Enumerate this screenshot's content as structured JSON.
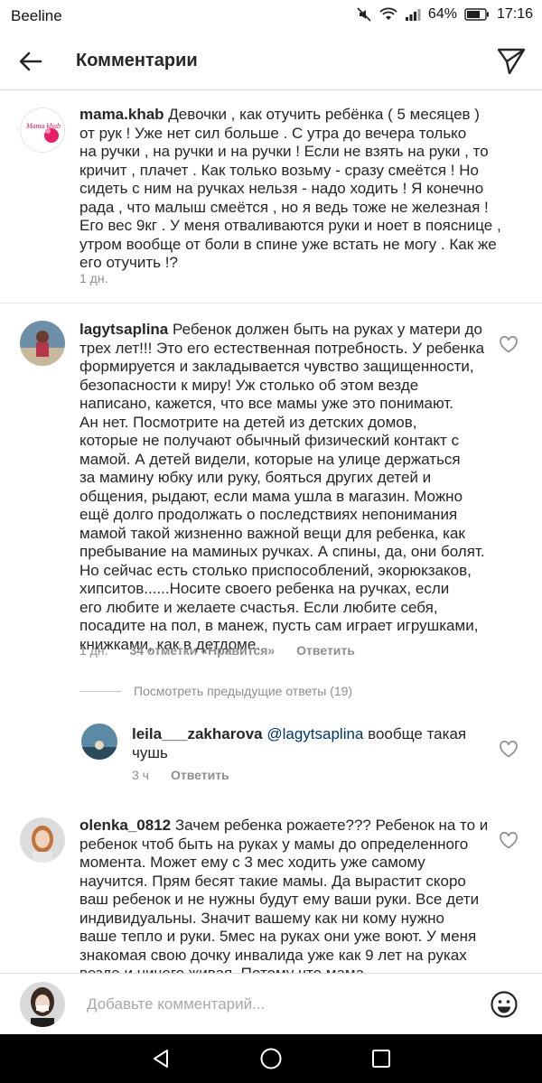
{
  "status_bar": {
    "carrier": "Beeline",
    "battery": "64%",
    "time": "17:16",
    "icons": [
      "mute-icon",
      "wifi-icon",
      "signal-icon",
      "battery-icon"
    ]
  },
  "header": {
    "title": "Комментарии",
    "back_icon": "back-arrow-icon",
    "share_icon": "direct-send-icon"
  },
  "comments": [
    {
      "user": "mama.khab",
      "avatar_text": "Mama khab",
      "lines": [
        "Девочки , как отучить ребёнка ( 5 месяцев )",
        "от рук ! Уже нет сил больше . С утра до вечера только",
        "на ручки , на ручки и на ручки ! Если не взять на руки , то",
        "кричит , плачет . Как только возьму - сразу смеётся ! Но",
        "сидеть с ним на ручках нельзя - надо ходить ! Я конечно",
        "рада , что малыш смеётся , но я ведь тоже не железная !",
        "Его вес 9кг . У меня отваливаются руки и ноет в пояснице ,",
        "утром вообще от боли в спине уже встать не могу . Как же",
        "его отучить !?"
      ],
      "time": "1 дн."
    },
    {
      "user": "lagytsaplina",
      "lines": [
        "Ребенок должен быть на руках у матери до",
        "трех лет!!! Это его естественная потребность. У ребенка",
        "формируется и закладывается чувство защищенности,",
        "безопасности к миру! Уж столько об этом везде",
        "написано,  кажется, что все мамы уже это понимают.",
        "Ан нет. Посмотрите на детей из детских домов,",
        "которые не получают обычный физический контакт с",
        "мамой. А детей видели, которые на улице держаться",
        "за мамину юбку или руку, бояться других детей и",
        "общения, рыдают, если мама ушла в магазин. Можно",
        "ещё долго продолжать о последствиях непонимания",
        "мамой такой жизненно важной вещи для ребенка, как",
        "пребывание на маминых ручках. А спины, да, они болят.",
        "Но сейчас есть столько приспособлений, экорюкзаков,",
        "хипситов......Носите своего ребенка на ручках, если",
        "его любите и желаете счастья. Если любите себя,",
        "посадите на пол, в манеж, пусть сам  играет игрушками,",
        "книжками, как в детдоме."
      ],
      "time": "1 дн.",
      "likes": "34 отметки «Нравится»",
      "reply": "Ответить"
    }
  ],
  "view_replies": "Посмотреть предыдущие ответы (19)",
  "reply": {
    "user": "leila___zakharova",
    "mention": "@lagytsaplina",
    "line1_rest": "вообще такая",
    "line2": "чушь",
    "time": "3 ч",
    "reply_label": "Ответить"
  },
  "comment3": {
    "user": "olenka_0812",
    "lines": [
      "Зачем ребенка рожаете??? Ребенок на то и",
      "ребенок чтоб быть на руках у мамы до определенного",
      "момента. Может ему с 3 мес ходить уже самому",
      "научится. Прям бесят такие мамы. Да вырастит скоро",
      "ваш ребенок и не нужны будут ему ваши руки. Все дети",
      "индивидуальны. Значит вашему как ни кому нужно",
      "ваше тепло и руки. 5мес на руках они уже воют. У меня",
      "знакомая свою дочку инвалида уже как 9 лет на руках",
      "везде и ничего живая. Потому что мама."
    ]
  },
  "composer": {
    "placeholder": "Добавьте комментарий...",
    "emoji_icon": "smiley-icon"
  },
  "nav": [
    "back-triangle-icon",
    "home-circle-icon",
    "recents-square-icon"
  ]
}
